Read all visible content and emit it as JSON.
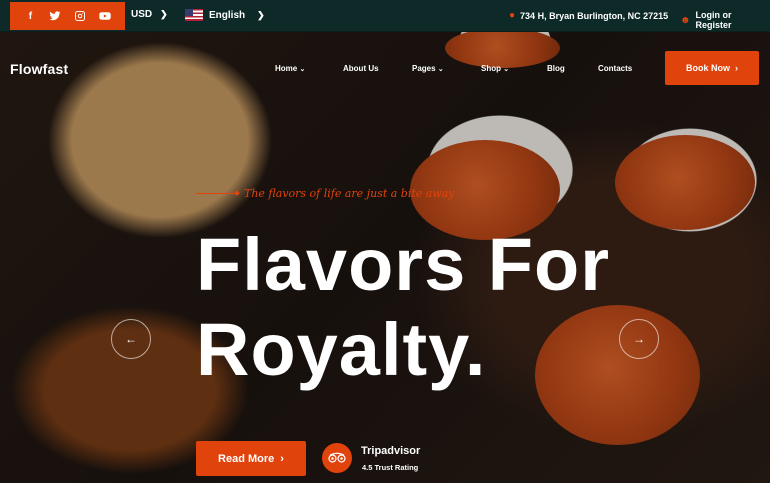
{
  "topbar": {
    "social": [
      "facebook-icon",
      "twitter-icon",
      "instagram-icon",
      "youtube-icon"
    ],
    "currency": "USD",
    "language": "English",
    "address": "734 H, Bryan Burlington, NC 27215",
    "login": "Login or Register"
  },
  "nav": {
    "logo": "Flowfast",
    "items": [
      "Home",
      "About Us",
      "Pages",
      "Shop",
      "Blog",
      "Contacts"
    ],
    "book_button": "Book Now"
  },
  "hero": {
    "tagline": "The flavors of life are just a bite away",
    "headline_line1": "Flavors For",
    "headline_line2": "Royalty.",
    "read_more": "Read More",
    "tripadvisor_name": "Tripadvisor",
    "tripadvisor_rating": "4.5 Trust Rating"
  },
  "colors": {
    "accent": "#e0430c",
    "topbar_bg": "#0d2a28"
  }
}
